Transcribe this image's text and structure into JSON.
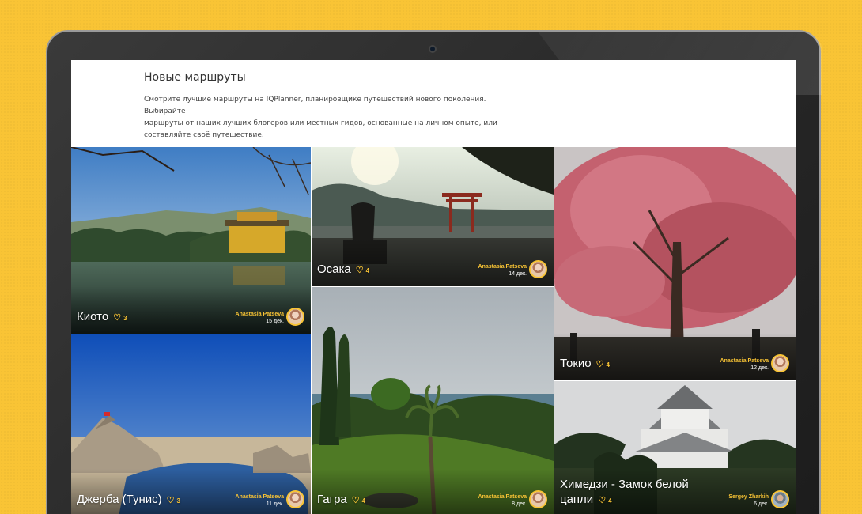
{
  "section": {
    "title": "Новые маршруты",
    "description_line1": "Смотрите лучшие маршруты на IQPlanner, планировщике путешествий нового поколения. Выбирайте",
    "description_line2": "маршруты от наших лучших блогеров или местных гидов, основанные на личном опыте, или",
    "description_line3": "составляйте своё путешествие."
  },
  "routes": [
    {
      "title": "Киото",
      "likes": "3",
      "author": "Anastasia Patseva",
      "date": "15 дек."
    },
    {
      "title": "Осака",
      "likes": "4",
      "author": "Anastasia Patseva",
      "date": "14 дек."
    },
    {
      "title": "Токио",
      "likes": "4",
      "author": "Anastasia Patseva",
      "date": "12 дек."
    },
    {
      "title": "Джерба (Тунис)",
      "likes": "3",
      "author": "Anastasia Patseva",
      "date": "11 дек."
    },
    {
      "title": "Гагра",
      "likes": "4",
      "author": "Anastasia Patseva",
      "date": "8 дек."
    },
    {
      "title": "Химедзи - Замок белой цапли",
      "likes": "4",
      "author": "Sergey Zharkih",
      "date": "6 дек."
    }
  ],
  "icons": {
    "like": "heart-icon",
    "camera": "webcam"
  },
  "colors": {
    "accent": "#f9c435",
    "background": "#f9c435"
  }
}
